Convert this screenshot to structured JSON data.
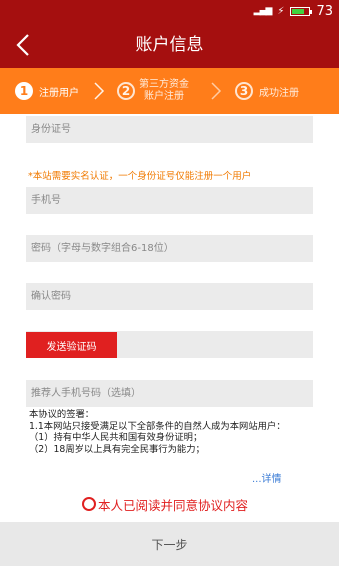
{
  "status_bar": {
    "battery_percent": "73",
    "battery_level": 0.73,
    "battery_color": "#3fd33f"
  },
  "header": {
    "title": "账户信息"
  },
  "steps": [
    {
      "num": "1",
      "label": "注册用户"
    },
    {
      "num": "2",
      "label_line1": "第三方资金",
      "label_line2": "账户注册"
    },
    {
      "num": "3",
      "label": "成功注册"
    }
  ],
  "form": {
    "id_card_placeholder": "身份证号",
    "note": "*本站需要实名认证，一个身份证号仅能注册一个用户",
    "phone_placeholder": "手机号",
    "password_placeholder": "密码（字母与数字组合6-18位）",
    "confirm_password_placeholder": "确认密码",
    "send_code_label": "发送验证码",
    "referrer_placeholder": "推荐人手机号码（选填）"
  },
  "agreement": {
    "lines": [
      "本协议的签署：",
      "1.1本网站只接受满足以下全部条件的自然人成为本网站用户：",
      "（1）持有中华人民共和国有效身份证明；",
      "（2）18周岁以上具有完全民事行为能力；"
    ],
    "details_label": "...详情",
    "consent_label": "本人已阅读并同意协议内容"
  },
  "footer": {
    "next_label": "下一步"
  },
  "colors": {
    "header_bg": "#a50f0f",
    "steps_bg": "#ff7d1a",
    "accent_red": "#e02020",
    "note_orange": "#f07a00",
    "link_blue": "#3a7bd5"
  }
}
